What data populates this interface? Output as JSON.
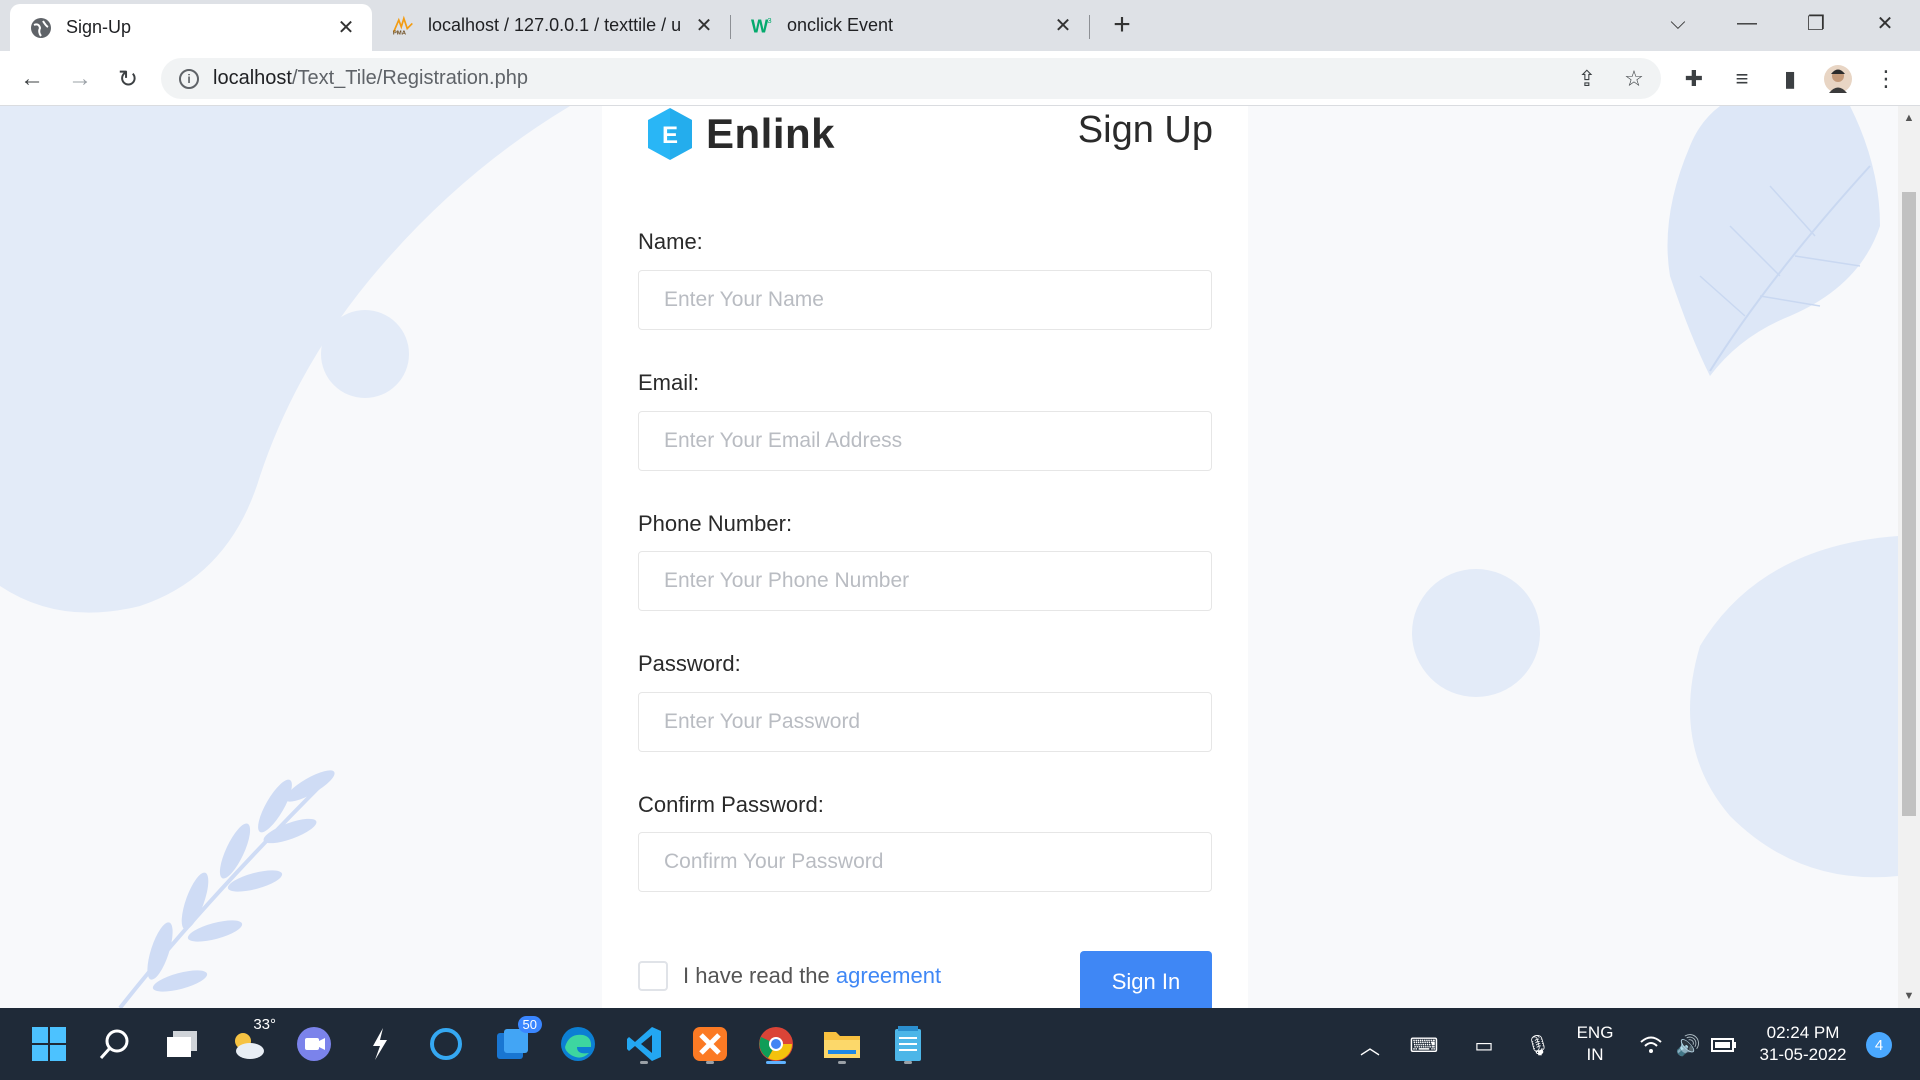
{
  "browser": {
    "tabs": [
      {
        "title": "Sign-Up",
        "icon": "globe-icon",
        "active": true
      },
      {
        "title": "localhost / 127.0.0.1 / texttile / u",
        "icon": "phpmyadmin-icon",
        "active": false
      },
      {
        "title": "onclick Event",
        "icon": "w3schools-icon",
        "active": false
      }
    ],
    "address": {
      "host": "localhost",
      "path": "/Text_Tile/Registration.php"
    }
  },
  "page": {
    "logo_letter": "E",
    "logo_text": "Enlink",
    "title": "Sign Up",
    "fields": [
      {
        "label": "Name:",
        "placeholder": "Enter Your Name",
        "value": ""
      },
      {
        "label": "Email:",
        "placeholder": "Enter Your Email Address",
        "value": ""
      },
      {
        "label": "Phone Number:",
        "placeholder": "Enter Your Phone Number",
        "value": ""
      },
      {
        "label": "Password:",
        "placeholder": "Enter Your Password",
        "value": ""
      },
      {
        "label": "Confirm Password:",
        "placeholder": "Confirm Your Password",
        "value": ""
      }
    ],
    "agreement_prefix": "I have read the ",
    "agreement_link": "agreement",
    "submit_label": "Sign In",
    "accent": "#3f87f5",
    "decor_color": "#e3ebf8"
  },
  "taskbar": {
    "weather_temp": "33°",
    "teams_badge": "50",
    "language": "ENG",
    "region": "IN",
    "time": "02:24 PM",
    "date": "31-05-2022",
    "notifications": "4"
  }
}
